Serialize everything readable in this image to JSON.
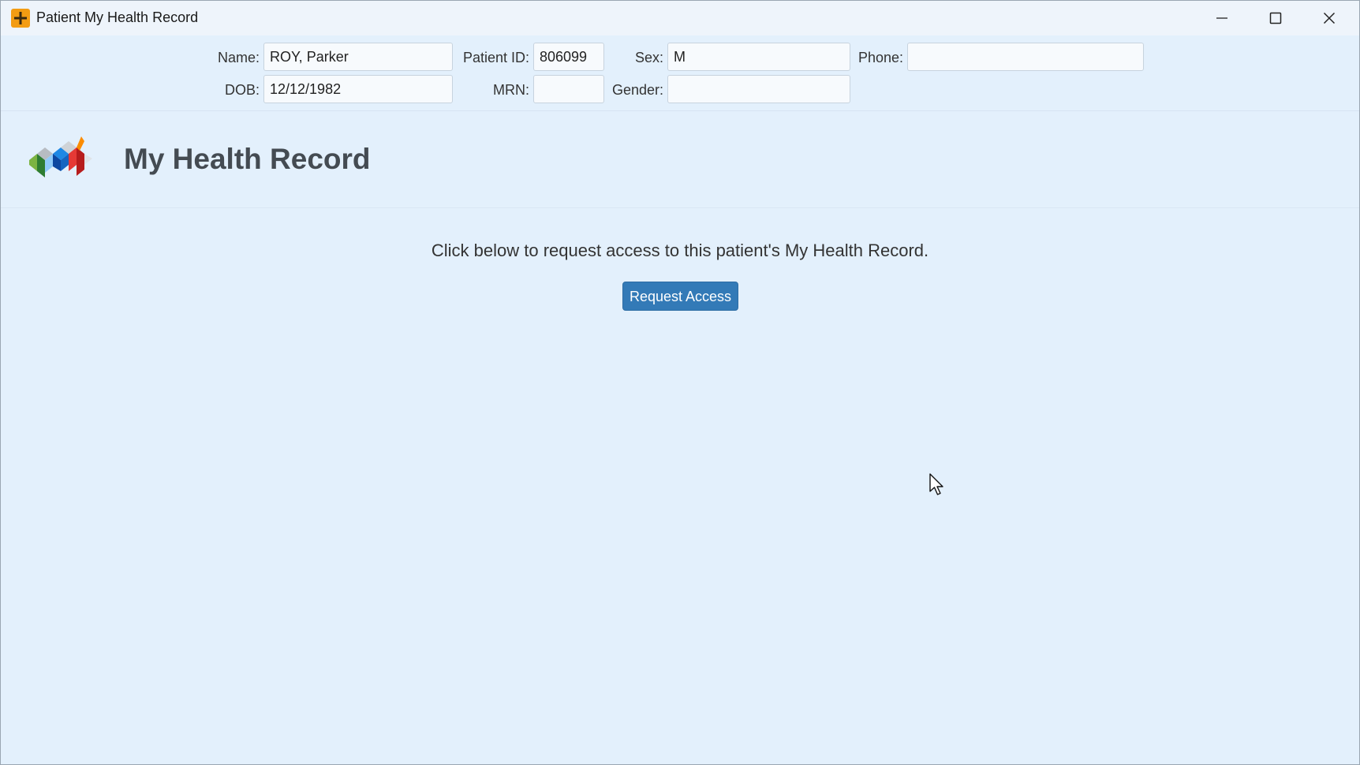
{
  "window": {
    "title": "Patient My Health Record",
    "accent_color": "#f39c12"
  },
  "patient": {
    "name_label": "Name:",
    "name_value": "ROY, Parker",
    "dob_label": "DOB:",
    "dob_value": "12/12/1982",
    "patient_id_label": "Patient ID:",
    "patient_id_value": "806099",
    "mrn_label": "MRN:",
    "mrn_value": "",
    "sex_label": "Sex:",
    "sex_value": "M",
    "gender_label": "Gender:",
    "gender_value": "",
    "phone_label": "Phone:",
    "phone_value": ""
  },
  "header": {
    "title": "My Health Record"
  },
  "main": {
    "message": "Click below to request access to this patient's My Health Record.",
    "request_button_label": "Request Access",
    "button_color": "#337ab7"
  },
  "icons": {
    "app": "plus-icon",
    "minimize": "minimize-icon",
    "maximize": "maximize-icon",
    "close": "close-icon",
    "logo": "my-health-record-logo",
    "cursor": "mouse-pointer-icon"
  }
}
